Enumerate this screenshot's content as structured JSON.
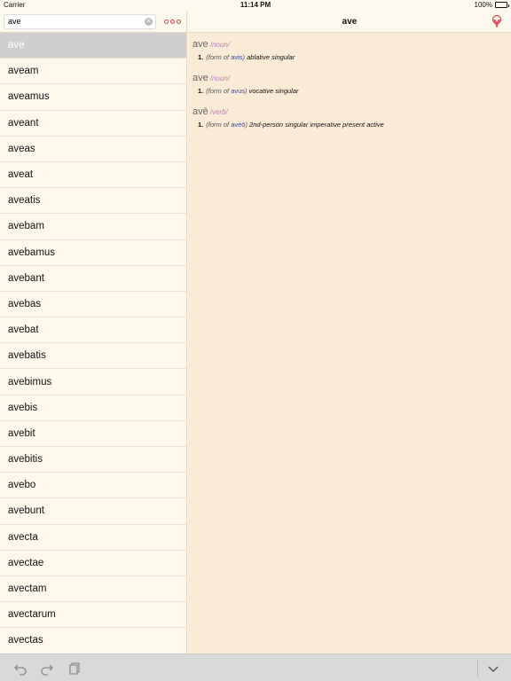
{
  "status": {
    "carrier": "Carrier",
    "time": "11:14 PM",
    "battery": "100%"
  },
  "search": {
    "value": "ave",
    "placeholder": ""
  },
  "detail": {
    "title": "ave"
  },
  "words": [
    "ave",
    "aveam",
    "aveamus",
    "aveant",
    "aveas",
    "aveat",
    "aveatis",
    "avebam",
    "avebamus",
    "avebant",
    "avebas",
    "avebat",
    "avebatis",
    "avebimus",
    "avebis",
    "avebit",
    "avebitis",
    "avebo",
    "avebunt",
    "avecta",
    "avectae",
    "avectam",
    "avectarum",
    "avectas"
  ],
  "selected_index": 0,
  "entries": [
    {
      "headword": "ave",
      "pos": "/noun/",
      "sense_num": "1.",
      "prefix": "(form of",
      "link": "avis",
      "suffix": ")",
      "gloss": "ablative singular"
    },
    {
      "headword": "ave",
      "pos": "/noun/",
      "sense_num": "1.",
      "prefix": "(form of",
      "link": "avus",
      "suffix": ")",
      "gloss": "vocative singular"
    },
    {
      "headword": "avē",
      "pos": "/verb/",
      "sense_num": "1.",
      "prefix": "(form of",
      "link": "aveō",
      "suffix": ")",
      "gloss": "2nd-person singular imperative present active"
    }
  ],
  "colors": {
    "accent": "#d8434f",
    "link": "#2b4cc4",
    "pos": "#b681b9"
  },
  "icons": [
    "clear-icon",
    "more-icon",
    "logo-icon",
    "undo-icon",
    "redo-icon",
    "copy-icon",
    "chevron-down-icon"
  ]
}
